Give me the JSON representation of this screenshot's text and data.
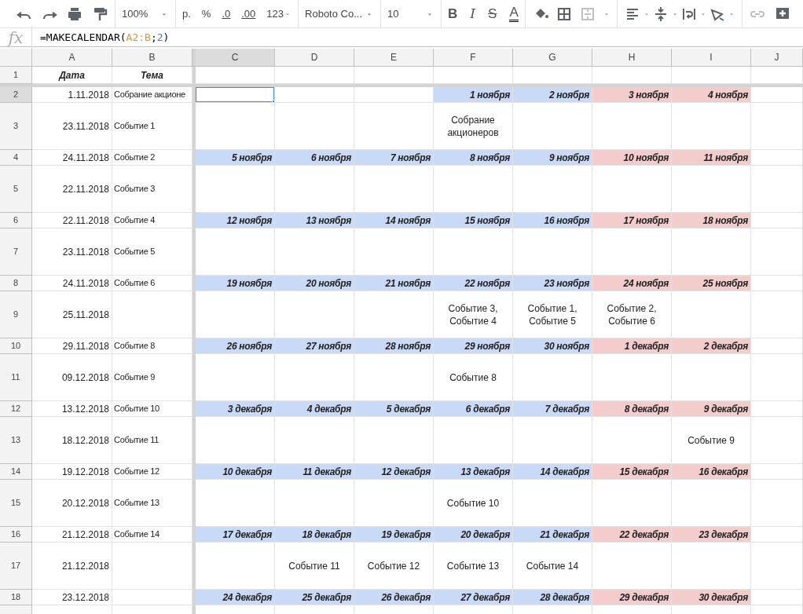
{
  "toolbar": {
    "zoom": "100%",
    "currency": "р.",
    "percent": "%",
    "decimal_less": ".0",
    "decimal_more": ".00",
    "number_format": "123",
    "font": "Roboto Co...",
    "font_size": "10",
    "bold": "B",
    "italic": "I",
    "strikethrough": "S",
    "text_color": "A"
  },
  "formula_bar": {
    "label": "fx",
    "tokens": [
      {
        "text": "=MAKECALENDAR("
      },
      {
        "text": "A2:B",
        "color": "#e69138"
      },
      {
        "text": ";"
      },
      {
        "text": "2",
        "color": "#3d85c6"
      },
      {
        "text": ")"
      }
    ]
  },
  "columns": [
    "A",
    "B",
    "C",
    "D",
    "E",
    "F",
    "G",
    "H",
    "I",
    "J"
  ],
  "header_row": {
    "number": "1",
    "date": "Дата",
    "topic": "Тема"
  },
  "rows": [
    {
      "number": "2",
      "date": "1.11.2018",
      "topic": "Собрание акционе",
      "kind": "week",
      "cells": [
        {
          "selected": true
        },
        {
          "selected": false
        },
        {
          "selected": false
        },
        {
          "text": "1 ноября",
          "color": "#c9daf8",
          "selected": false
        },
        {
          "text": "2 ноября",
          "color": "#c9daf8",
          "selected": false
        },
        {
          "text": "3 ноября",
          "color": "#f4cccc",
          "selected": false
        },
        {
          "text": "4 ноября",
          "color": "#f4cccc",
          "selected": false
        }
      ]
    },
    {
      "number": "3",
      "date": "23.11.2018",
      "topic": "Событие 1",
      "kind": "events",
      "cells": [
        null,
        null,
        null,
        "Собрание акционеров",
        null,
        null,
        null
      ]
    },
    {
      "number": "4",
      "date": "24.11.2018",
      "topic": "Событие 2",
      "kind": "week",
      "cells": [
        {
          "text": "5 ноября",
          "color": "#c9daf8",
          "selected": false
        },
        {
          "text": "6 ноября",
          "color": "#c9daf8",
          "selected": false
        },
        {
          "text": "7 ноября",
          "color": "#c9daf8",
          "selected": false
        },
        {
          "text": "8 ноября",
          "color": "#c9daf8",
          "selected": false
        },
        {
          "text": "9 ноября",
          "color": "#c9daf8",
          "selected": false
        },
        {
          "text": "10 ноября",
          "color": "#f4cccc",
          "selected": false
        },
        {
          "text": "11 ноября",
          "color": "#f4cccc",
          "selected": false
        }
      ]
    },
    {
      "number": "5",
      "date": "22.11.2018",
      "topic": "Событие 3",
      "kind": "events",
      "cells": [
        null,
        null,
        null,
        null,
        null,
        null,
        null
      ]
    },
    {
      "number": "6",
      "date": "22.11.2018",
      "topic": "Событие 4",
      "kind": "week",
      "cells": [
        {
          "text": "12 ноября",
          "color": "#c9daf8",
          "selected": false
        },
        {
          "text": "13 ноября",
          "color": "#c9daf8",
          "selected": false
        },
        {
          "text": "14 ноября",
          "color": "#c9daf8",
          "selected": false
        },
        {
          "text": "15 ноября",
          "color": "#c9daf8",
          "selected": false
        },
        {
          "text": "16 ноября",
          "color": "#c9daf8",
          "selected": false
        },
        {
          "text": "17 ноября",
          "color": "#f4cccc",
          "selected": false
        },
        {
          "text": "18 ноября",
          "color": "#f4cccc",
          "selected": false
        }
      ]
    },
    {
      "number": "7",
      "date": "23.11.2018",
      "topic": "Событие 5",
      "kind": "events",
      "cells": [
        null,
        null,
        null,
        null,
        null,
        null,
        null
      ]
    },
    {
      "number": "8",
      "date": "24.11.2018",
      "topic": "Событие 6",
      "kind": "week",
      "cells": [
        {
          "text": "19 ноября",
          "color": "#c9daf8",
          "selected": false
        },
        {
          "text": "20 ноября",
          "color": "#c9daf8",
          "selected": false
        },
        {
          "text": "21 ноября",
          "color": "#c9daf8",
          "selected": false
        },
        {
          "text": "22 ноября",
          "color": "#c9daf8",
          "selected": false
        },
        {
          "text": "23 ноября",
          "color": "#c9daf8",
          "selected": false
        },
        {
          "text": "24 ноября",
          "color": "#f4cccc",
          "selected": false
        },
        {
          "text": "25 ноября",
          "color": "#f4cccc",
          "selected": false
        }
      ]
    },
    {
      "number": "9",
      "date": "25.11.2018",
      "kind": "events",
      "cells": [
        null,
        null,
        null,
        "Событие 3, Событие 4",
        "Событие 1, Событие 5",
        "Событие 2, Событие 6",
        null
      ]
    },
    {
      "number": "10",
      "date": "29.11.2018",
      "topic": "Событие 8",
      "kind": "week",
      "cells": [
        {
          "text": "26 ноября",
          "color": "#c9daf8",
          "selected": false
        },
        {
          "text": "27 ноября",
          "color": "#c9daf8",
          "selected": false
        },
        {
          "text": "28 ноября",
          "color": "#c9daf8",
          "selected": false
        },
        {
          "text": "29 ноября",
          "color": "#c9daf8",
          "selected": false
        },
        {
          "text": "30 ноября",
          "color": "#c9daf8",
          "selected": false
        },
        {
          "text": "1 декабря",
          "color": "#f4cccc",
          "selected": false
        },
        {
          "text": "2 декабря",
          "color": "#f4cccc",
          "selected": false
        }
      ]
    },
    {
      "number": "11",
      "date": "09.12.2018",
      "topic": "Событие 9",
      "kind": "events",
      "cells": [
        null,
        null,
        null,
        "Событие 8",
        null,
        null,
        null
      ]
    },
    {
      "number": "12",
      "date": "13.12.2018",
      "topic": "Событие 10",
      "kind": "week",
      "cells": [
        {
          "text": "3 декабря",
          "color": "#c9daf8",
          "selected": false
        },
        {
          "text": "4 декабря",
          "color": "#c9daf8",
          "selected": false
        },
        {
          "text": "5 декабря",
          "color": "#c9daf8",
          "selected": false
        },
        {
          "text": "6 декабря",
          "color": "#c9daf8",
          "selected": false
        },
        {
          "text": "7 декабря",
          "color": "#c9daf8",
          "selected": false
        },
        {
          "text": "8 декабря",
          "color": "#f4cccc",
          "selected": false
        },
        {
          "text": "9 декабря",
          "color": "#f4cccc",
          "selected": false
        }
      ]
    },
    {
      "number": "13",
      "date": "18.12.2018",
      "topic": "Событие 11",
      "kind": "events",
      "cells": [
        null,
        null,
        null,
        null,
        null,
        null,
        "Событие 9"
      ]
    },
    {
      "number": "14",
      "date": "19.12.2018",
      "topic": "Событие 12",
      "kind": "week",
      "cells": [
        {
          "text": "10 декабря",
          "color": "#c9daf8",
          "selected": false
        },
        {
          "text": "11 декабря",
          "color": "#c9daf8",
          "selected": false
        },
        {
          "text": "12 декабря",
          "color": "#c9daf8",
          "selected": false
        },
        {
          "text": "13 декабря",
          "color": "#c9daf8",
          "selected": false
        },
        {
          "text": "14 декабря",
          "color": "#c9daf8",
          "selected": false
        },
        {
          "text": "15 декабря",
          "color": "#f4cccc",
          "selected": false
        },
        {
          "text": "16 декабря",
          "color": "#f4cccc",
          "selected": false
        }
      ]
    },
    {
      "number": "15",
      "date": "20.12.2018",
      "topic": "Событие 13",
      "kind": "events",
      "cells": [
        null,
        null,
        null,
        "Событие 10",
        null,
        null,
        null
      ]
    },
    {
      "number": "16",
      "date": "21.12.2018",
      "topic": "Событие 14",
      "kind": "week",
      "cells": [
        {
          "text": "17 декабря",
          "color": "#c9daf8",
          "selected": false
        },
        {
          "text": "18 декабря",
          "color": "#c9daf8",
          "selected": false
        },
        {
          "text": "19 декабря",
          "color": "#c9daf8",
          "selected": false
        },
        {
          "text": "20 декабря",
          "color": "#c9daf8",
          "selected": false
        },
        {
          "text": "21 декабря",
          "color": "#c9daf8",
          "selected": false
        },
        {
          "text": "22 декабря",
          "color": "#f4cccc",
          "selected": false
        },
        {
          "text": "23 декабря",
          "color": "#f4cccc",
          "selected": false
        }
      ]
    },
    {
      "number": "17",
      "date": "21.12.2018",
      "kind": "events",
      "cells": [
        null,
        "Событие 11",
        "Событие 12",
        "Событие 13",
        "Событие 14",
        null,
        null
      ]
    },
    {
      "number": "18",
      "date": "23.12.2018",
      "kind": "week",
      "cells": [
        {
          "text": "24 декабря",
          "color": "#c9daf8",
          "selected": false
        },
        {
          "text": "25 декабря",
          "color": "#c9daf8",
          "selected": false
        },
        {
          "text": "26 декабря",
          "color": "#c9daf8",
          "selected": false
        },
        {
          "text": "27 декабря",
          "color": "#c9daf8",
          "selected": false
        },
        {
          "text": "28 декабря",
          "color": "#c9daf8",
          "selected": false
        },
        {
          "text": "29 декабря",
          "color": "#f4cccc",
          "selected": false
        },
        {
          "text": "30 декабря",
          "color": "#f4cccc",
          "selected": false
        }
      ]
    }
  ]
}
